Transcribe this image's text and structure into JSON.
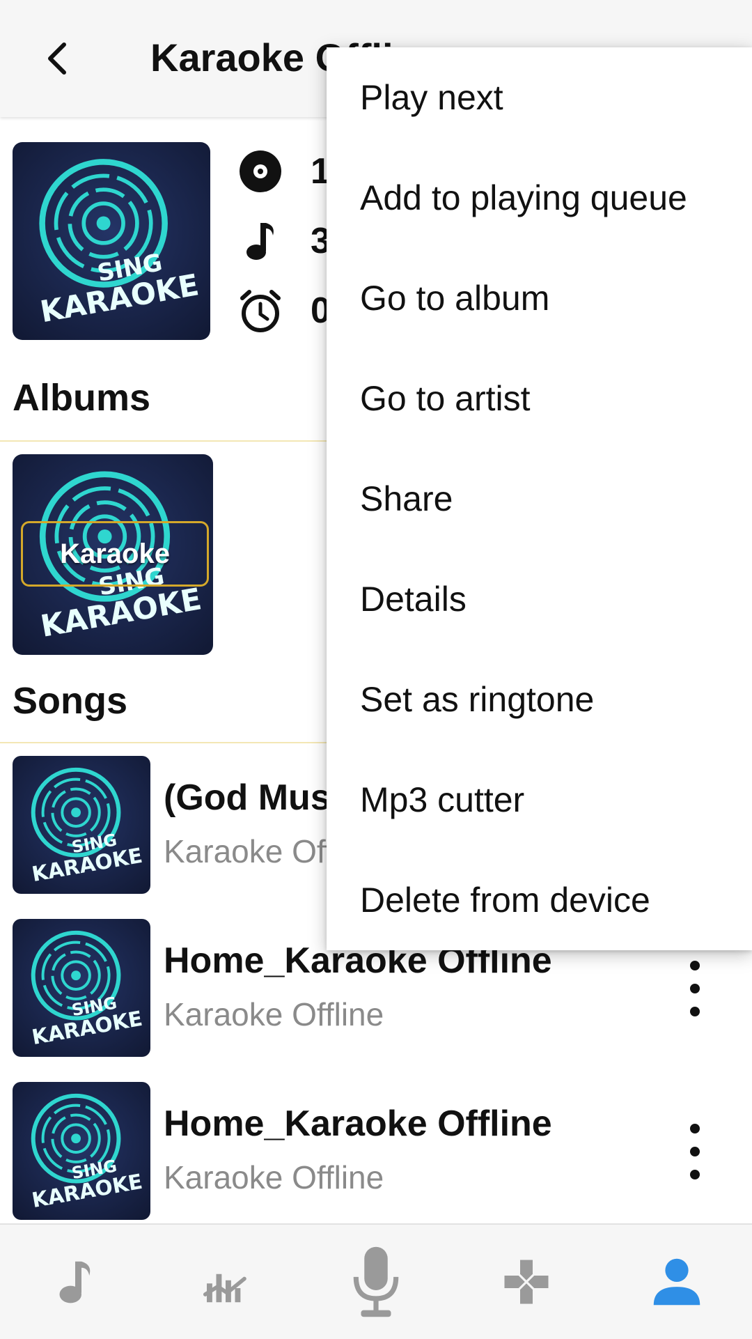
{
  "appbar": {
    "title": "Karaoke Offline",
    "back_icon": "chevron-left-icon"
  },
  "header": {
    "stats": [
      {
        "icon": "disc-icon",
        "value": "1"
      },
      {
        "icon": "music-note-icon",
        "value": "3"
      },
      {
        "icon": "alarm-clock-icon",
        "value": "0"
      }
    ]
  },
  "artwork": {
    "line1": "SING",
    "line2": "KARAOKE"
  },
  "sections": {
    "albums": "Albums",
    "songs": "Songs"
  },
  "albums": [
    {
      "label": "Karaoke"
    }
  ],
  "songs": [
    {
      "title": "(God Music)",
      "subtitle": "Karaoke Offline"
    },
    {
      "title": "Home_Karaoke Offline",
      "subtitle": "Karaoke Offline"
    },
    {
      "title": "Home_Karaoke Offline",
      "subtitle": "Karaoke Offline"
    }
  ],
  "menu": {
    "items": [
      "Play next",
      "Add to playing queue",
      "Go to album",
      "Go to artist",
      "Share",
      "Details",
      "Set as ringtone",
      "Mp3 cutter",
      "Delete from device"
    ]
  },
  "bottom_nav": [
    {
      "icon": "music-note-icon",
      "active": false
    },
    {
      "icon": "chart-icon",
      "active": false
    },
    {
      "icon": "microphone-icon",
      "active": false
    },
    {
      "icon": "gamepad-icon",
      "active": false
    },
    {
      "icon": "profile-icon",
      "active": true
    }
  ],
  "colors": {
    "accent": "#2f8fe6",
    "nav_inactive": "#9a9a9a",
    "art_bg": "#1a2342",
    "art_neon": "#2fd6cf",
    "divider": "#f3e7b4"
  }
}
